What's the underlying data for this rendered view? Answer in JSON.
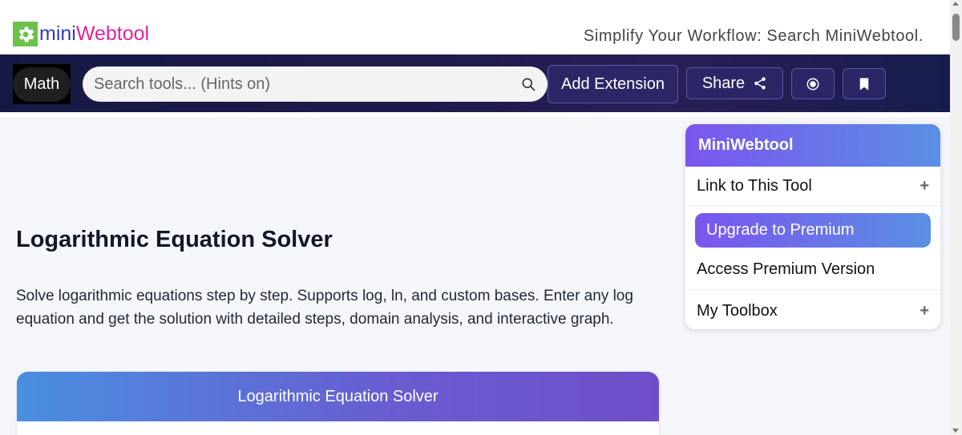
{
  "header": {
    "logo_part1": "mini",
    "logo_part2": "Webtool",
    "tagline": "Simplify Your Workflow: Search MiniWebtool."
  },
  "navbar": {
    "category_label": "Math",
    "search_placeholder": "Search tools... (Hints on)",
    "add_extension_label": "Add Extension",
    "share_label": "Share"
  },
  "main": {
    "title": "Logarithmic Equation Solver",
    "description": "Solve logarithmic equations step by step. Supports log, ln, and custom bases. Enter any log equation and get the solution with detailed steps, domain analysis, and interactive graph.",
    "card_title": "Logarithmic Equation Solver"
  },
  "sidebar": {
    "title": "MiniWebtool",
    "items": [
      {
        "label": "Link to This Tool",
        "expandable": "+"
      },
      {
        "label": "Upgrade to Premium"
      },
      {
        "label": "Access Premium Version"
      },
      {
        "label": "My Toolbox",
        "expandable": "+"
      }
    ]
  },
  "colors": {
    "brand_blue": "#2f3fb7",
    "brand_pink": "#e0249b",
    "logo_green": "#6cc24a",
    "nav_dark": "#1e1b4b",
    "accent_purple": "#7b55ef",
    "accent_blue": "#5a8fe4"
  }
}
